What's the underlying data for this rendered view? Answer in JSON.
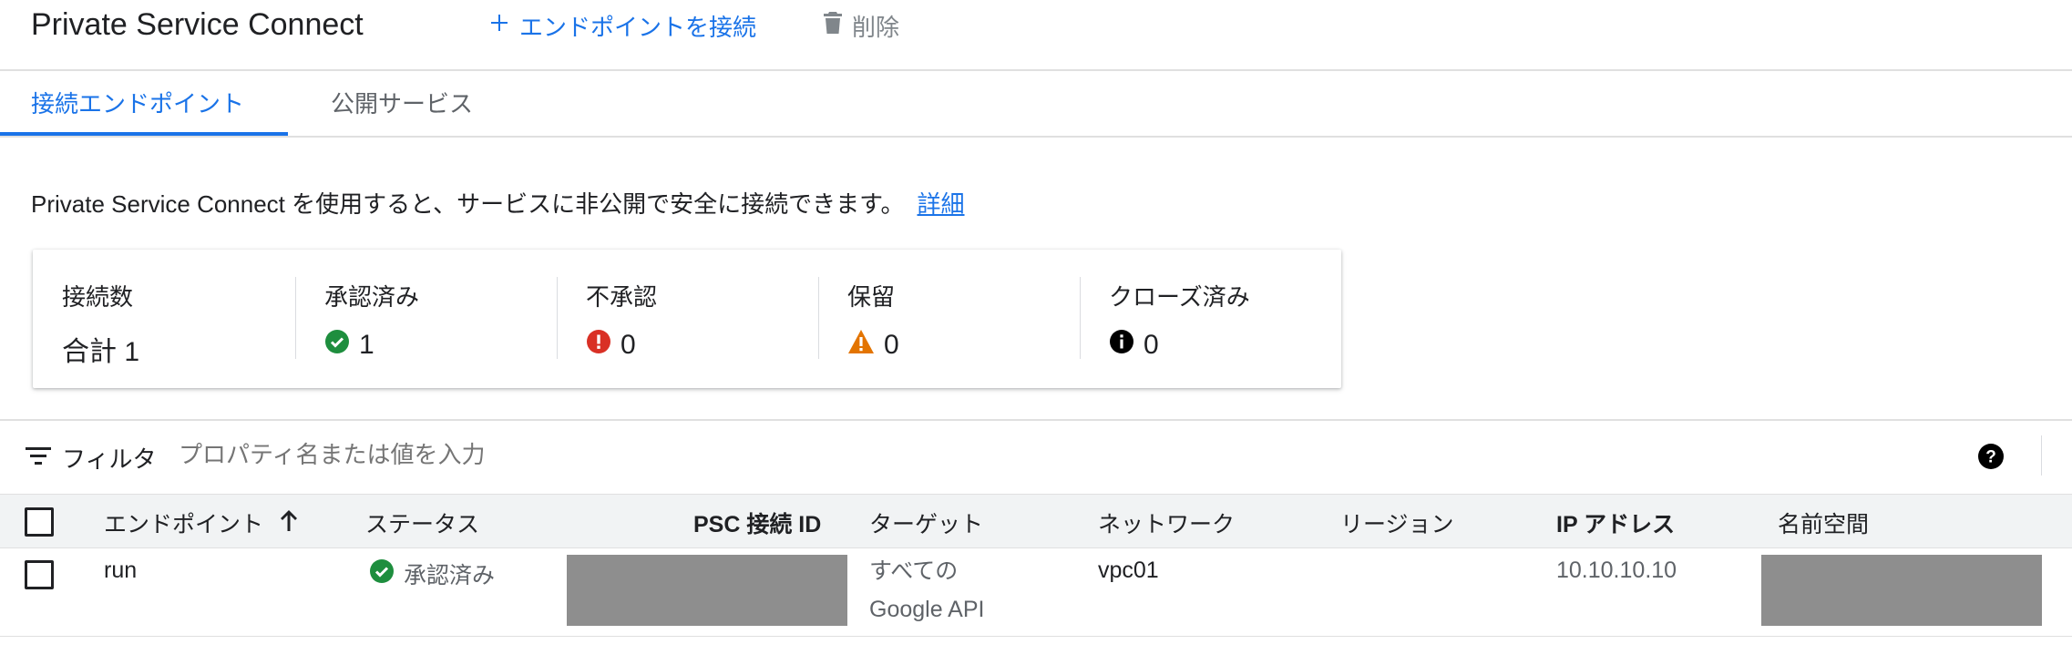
{
  "header": {
    "title": "Private Service Connect",
    "connect_label": "エンドポイントを接続",
    "delete_label": "削除"
  },
  "tabs": [
    {
      "label": "接続エンドポイント",
      "active": true
    },
    {
      "label": "公開サービス",
      "active": false
    }
  ],
  "info": {
    "text": "Private Service Connect を使用すると、サービスに非公開で安全に接続できます。",
    "link": "詳細"
  },
  "summary": {
    "connections": {
      "label": "接続数",
      "value": "合計 1"
    },
    "accepted": {
      "label": "承認済み",
      "value": "1"
    },
    "rejected": {
      "label": "不承認",
      "value": "0"
    },
    "pending": {
      "label": "保留",
      "value": "0"
    },
    "closed": {
      "label": "クローズ済み",
      "value": "0"
    }
  },
  "filter": {
    "label": "フィルタ",
    "placeholder": "プロパティ名または値を入力"
  },
  "table": {
    "columns": [
      "エンドポイント",
      "ステータス",
      "PSC 接続 ID",
      "ターゲット",
      "ネットワーク",
      "リージョン",
      "IP アドレス",
      "名前空間"
    ],
    "rows": [
      {
        "endpoint": "run",
        "status": "承認済み",
        "target_line1": "すべての",
        "target_line2": "Google API",
        "network": "vpc01",
        "ip": "10.10.10.10"
      }
    ]
  },
  "colors": {
    "accent": "#1a73e8",
    "success": "#1e8e3e",
    "error": "#d93025",
    "warning": "#e37400"
  }
}
